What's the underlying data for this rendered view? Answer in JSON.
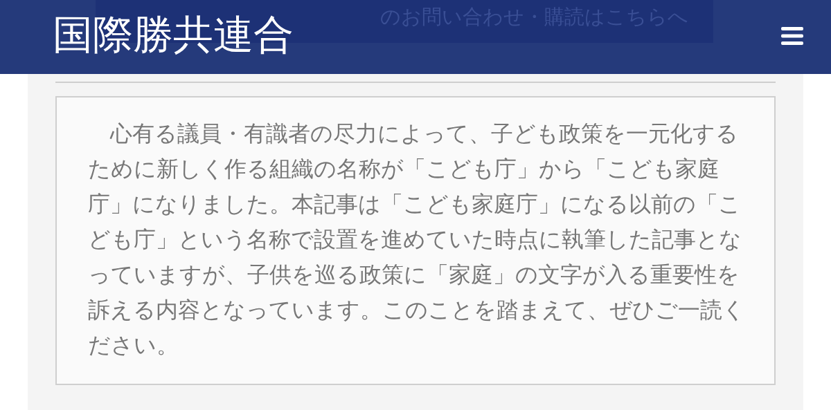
{
  "header": {
    "logo": "国際勝共連合",
    "banner": "のお問い合わせ・購読はこちらへ"
  },
  "notice": {
    "text": "心有る議員・有識者の尽力によって、子ども政策を一元化するために新しく作る組織の名称が「こども庁」から「こども家庭庁」になりました。本記事は「こども家庭庁」になる以前の「こども庁」という名称で設置を進めていた時点に執筆した記事となっていますが、子供を巡る政策に「家庭」の文字が入る重要性を訴える内容となっています。このことを踏まえて、ぜひご一読ください。"
  }
}
